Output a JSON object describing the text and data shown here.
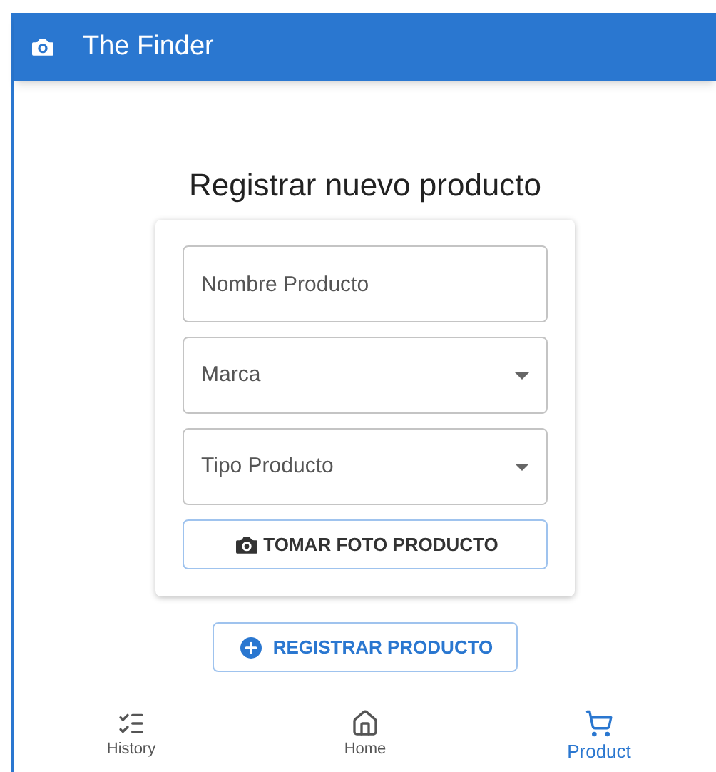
{
  "app_bar": {
    "title": "The Finder"
  },
  "form": {
    "heading": "Registrar nuevo producto",
    "fields": [
      {
        "kind": "text",
        "placeholder": "Nombre Producto"
      },
      {
        "kind": "select",
        "placeholder": "Marca"
      },
      {
        "kind": "select",
        "placeholder": "Tipo Producto"
      }
    ],
    "photo_button": "TOMAR FOTO PRODUCTO"
  },
  "submit_button": "REGISTRAR PRODUCTO",
  "bottom_nav": [
    {
      "kind": "history",
      "label": "History",
      "selected": false
    },
    {
      "kind": "home",
      "label": "Home",
      "selected": false
    },
    {
      "kind": "product",
      "label": "Product",
      "selected": true
    }
  ]
}
